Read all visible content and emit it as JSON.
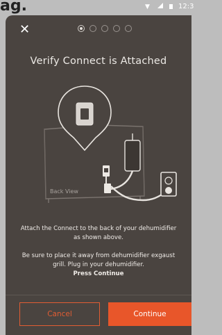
{
  "status": {
    "time": "12:3"
  },
  "header": {
    "steps_total": 5,
    "step_current": 1
  },
  "title": "Verify Connect is Attached",
  "illustration": {
    "back_label": "Back View"
  },
  "instructions": {
    "line1": "Attach the Connect to the back of your dehumidifier as shown above.",
    "line2": "Be sure to place it away from dehumidifier exgaust grill. Plug in your dehumidifier.",
    "line3": "Press Continue"
  },
  "buttons": {
    "cancel": "Cancel",
    "continue": "Continue"
  },
  "colors": {
    "card": "#4a4440",
    "accent": "#e8562a",
    "page": "#bdbdbd"
  }
}
